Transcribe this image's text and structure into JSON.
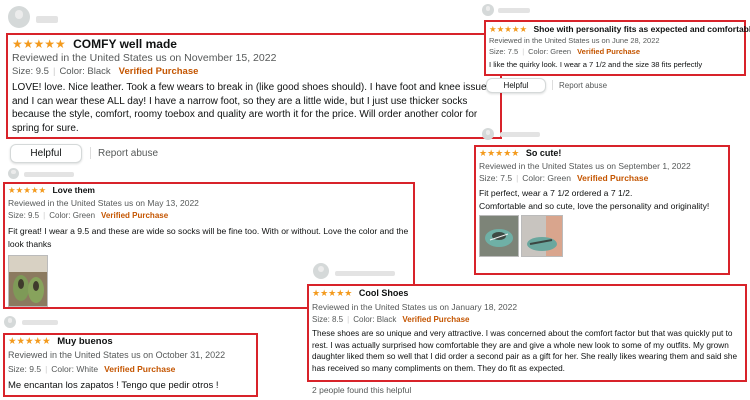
{
  "colors": {
    "star": "#f39a1d",
    "highlight_border": "#d8232a",
    "verified": "#c45500",
    "meta": "#565959"
  },
  "star_glyphs": "★★★★★",
  "reviews": [
    {
      "rating": 5,
      "title": "COMFY well made",
      "reviewed": "Reviewed in the United States us on November 15, 2022",
      "size": "Size: 9.5",
      "color": "Color: Black",
      "verified": "Verified Purchase",
      "body": "LOVE! love. Nice leather. Took a few wears to break in (like good shoes should). I have foot and knee issues and I can wear these ALL day! I have a narrow foot, so they are a little wide, but I just use thicker socks because the style, comfort, roomy toebox and quality are worth it for the price. Will order another color for spring for sure.",
      "helpful_label": "Helpful",
      "report_label": "Report abuse"
    },
    {
      "rating": 5,
      "title": "Shoe with personality fits as expected and comfortable",
      "reviewed": "Reviewed in the United States us on June 28, 2022",
      "size": "Size: 7.5",
      "color": "Color: Green",
      "verified": "Verified Purchase",
      "body": "I like the quirky look. I wear a 7 1/2 and the size 38 fits perfectly",
      "helpful_label": "Helpful",
      "report_label": "Report abuse"
    },
    {
      "rating": 5,
      "title": "So cute!",
      "reviewed": "Reviewed in the United States us on September 1, 2022",
      "size": "Size: 7.5",
      "color": "Color: Green",
      "verified": "Verified Purchase",
      "body1": "Fit perfect, wear a 7 1/2 ordered a 7 1/2.",
      "body2": "Comfortable and so cute, love the personality and originality!"
    },
    {
      "rating": 5,
      "title": "Love them",
      "reviewed": "Reviewed in the United States us on May 13, 2022",
      "size": "Size: 9.5",
      "color": "Color: Green",
      "verified": "Verified Purchase",
      "body": "Fit great! I wear a 9.5 and these are wide so socks will be fine too. With or without. Love the color and the look thanks"
    },
    {
      "rating": 5,
      "title": "Cool Shoes",
      "reviewed": "Reviewed in the United States us on January 18, 2022",
      "size": "Size: 8.5",
      "color": "Color: Black",
      "verified": "Verified Purchase",
      "body": "These shoes are so unique and very attractive. I was concerned about the comfort factor but that was quickly put to rest. I was actually surprised how comfortable they are and give a whole new look to some of my outfits. My grown daughter liked them so well that I did order a second pair as a gift for her. She really likes wearing them and said she has received so many compliments on them. They do fit as expected.",
      "helpful_count": "2 people found this helpful"
    },
    {
      "rating": 5,
      "title": "Muy buenos",
      "reviewed": "Reviewed in the United States us on October 31, 2022",
      "size": "Size: 9.5",
      "color": "Color: White",
      "verified": "Verified Purchase",
      "body": "Me encantan los zapatos ! Tengo que pedir otros !"
    }
  ]
}
